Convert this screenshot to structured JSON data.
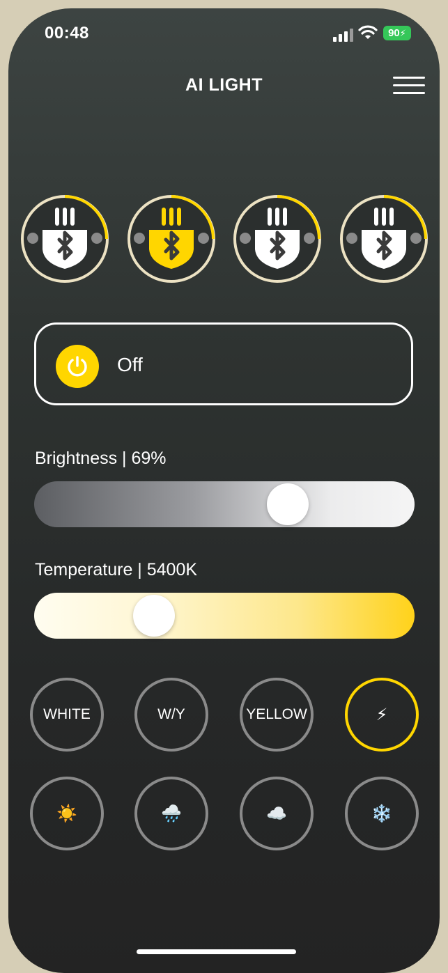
{
  "status_bar": {
    "time": "00:48",
    "battery": "90",
    "battery_color": "#35c759"
  },
  "header": {
    "title": "AI LIGHT",
    "menu_icon": "hamburger-menu-icon"
  },
  "devices": [
    {
      "icon": "bluetooth-lamp-icon",
      "selected": false
    },
    {
      "icon": "bluetooth-lamp-icon",
      "selected": true
    },
    {
      "icon": "bluetooth-lamp-icon",
      "selected": false
    },
    {
      "icon": "bluetooth-lamp-icon",
      "selected": false
    }
  ],
  "power": {
    "label": "Off",
    "icon": "power-icon",
    "color": "#ffd600"
  },
  "brightness": {
    "label": "Brightness | 69%",
    "value_percent": 69
  },
  "temperature": {
    "label": "Temperature | 5400K",
    "value_kelvin": 5400
  },
  "modes": [
    {
      "label": "WHITE",
      "active": false
    },
    {
      "label": "W/Y",
      "active": false
    },
    {
      "label": "YELLOW",
      "active": false
    },
    {
      "label": "⚡",
      "icon": "lightning-icon",
      "active": true
    }
  ],
  "scenes": [
    {
      "label": "☀️",
      "icon": "sun-icon"
    },
    {
      "label": "🌧️",
      "icon": "rain-cloud-icon"
    },
    {
      "label": "☁️",
      "icon": "cloud-icon"
    },
    {
      "label": "❄️",
      "icon": "snowflake-icon"
    }
  ],
  "colors": {
    "accent": "#ffd600",
    "ring_inactive": "#8a8a8a"
  }
}
